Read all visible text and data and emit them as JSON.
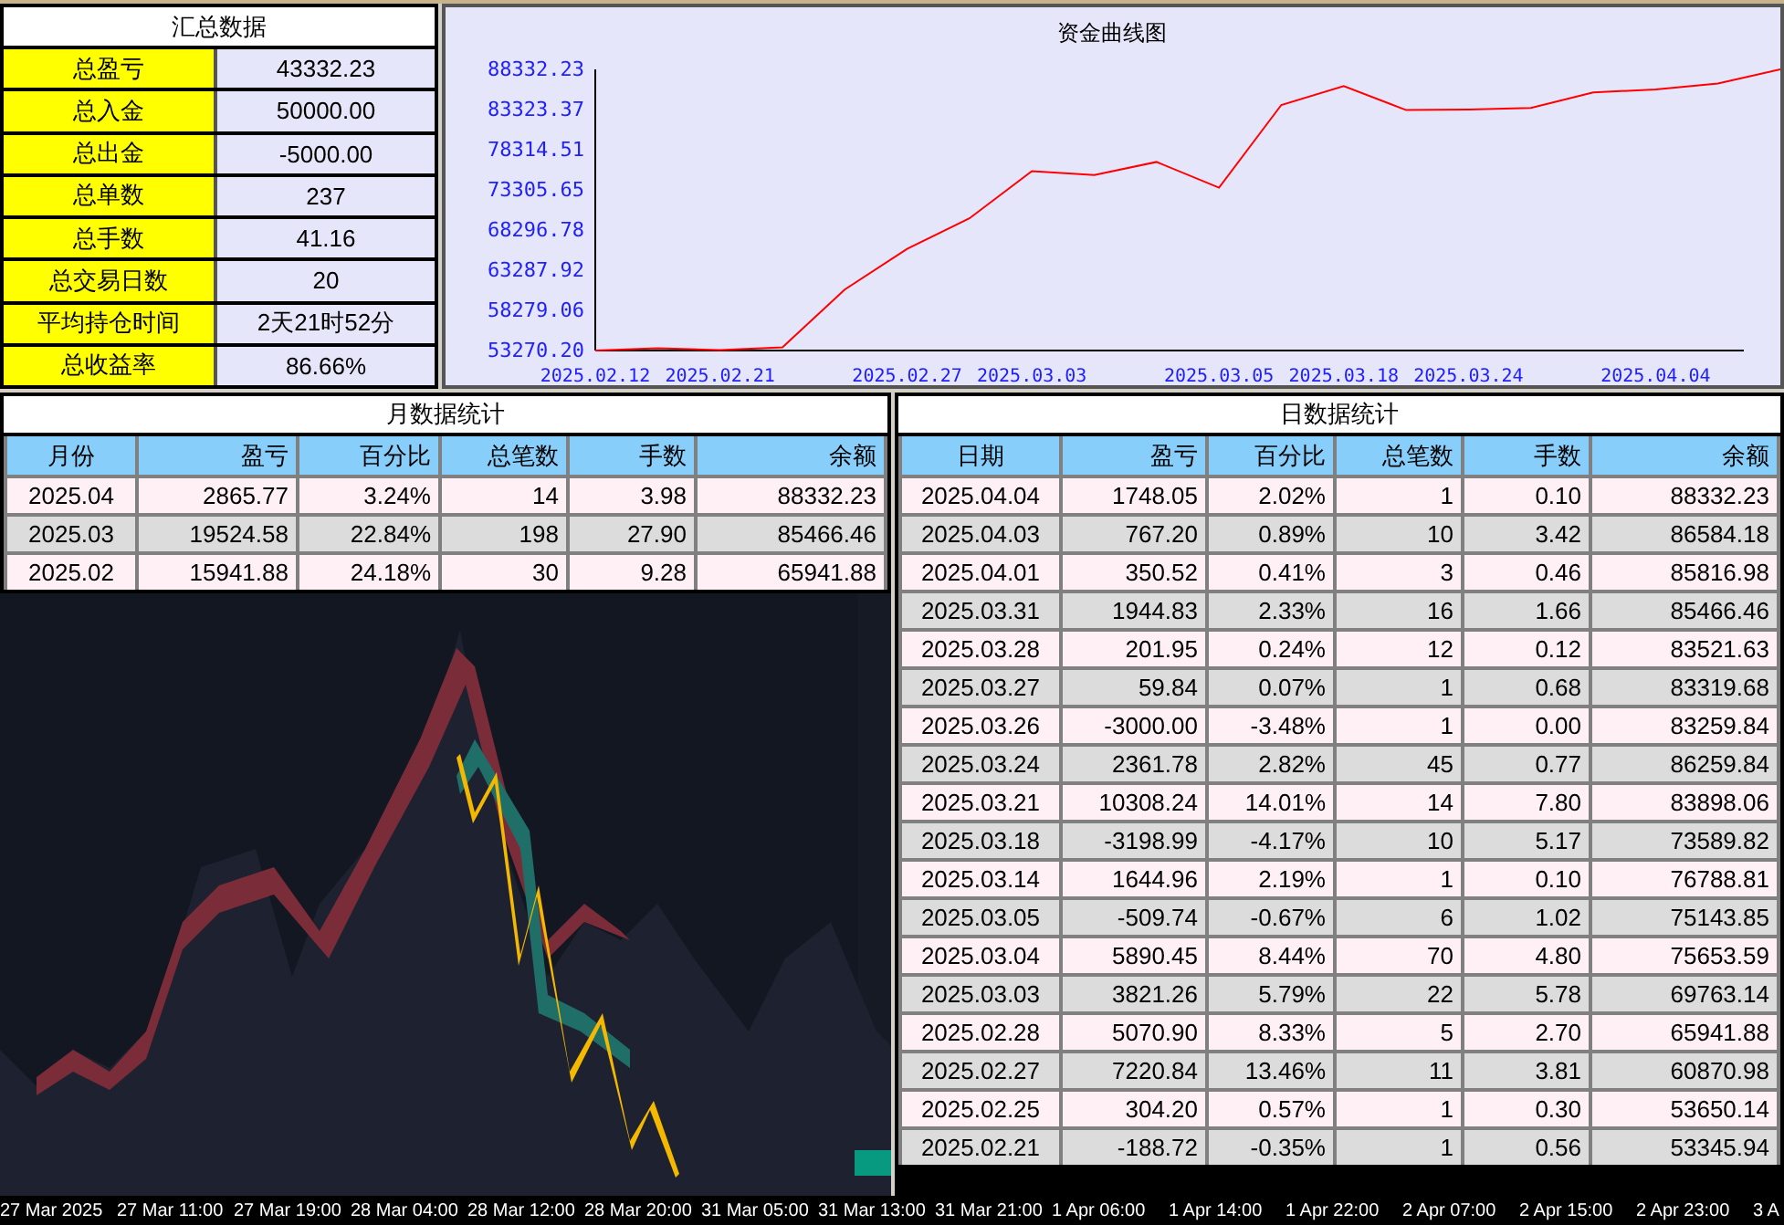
{
  "summary": {
    "title": "汇总数据",
    "rows": [
      {
        "label": "总盈亏",
        "value": "43332.23"
      },
      {
        "label": "总入金",
        "value": "50000.00"
      },
      {
        "label": "总出金",
        "value": "-5000.00"
      },
      {
        "label": "总单数",
        "value": "237"
      },
      {
        "label": "总手数",
        "value": "41.16"
      },
      {
        "label": "总交易日数",
        "value": "20"
      },
      {
        "label": "平均持仓时间",
        "value": "2天21时52分"
      },
      {
        "label": "总收益率",
        "value": "86.66%"
      }
    ]
  },
  "equity_chart": {
    "title": "资金曲线图",
    "chart_data": {
      "type": "line",
      "x": [
        "2025.02.12",
        null,
        "2025.02.21",
        null,
        null,
        "2025.02.27",
        null,
        "2025.03.03",
        null,
        null,
        "2025.03.05",
        null,
        "2025.03.18",
        null,
        "2025.03.24",
        null,
        null,
        "2025.04.04",
        null,
        null
      ],
      "series": [
        {
          "color": "#ff0000",
          "values": [
            53270.2,
            53535,
            53346,
            53650,
            60871,
            65942,
            69763,
            75654,
            75144,
            76789,
            73590,
            83898,
            86260,
            83260,
            83320,
            83522,
            85466,
            85817,
            86584,
            88332.23
          ]
        }
      ],
      "ylim": [
        53270.2,
        88332.23
      ],
      "yticks": [
        {
          "value": 88332.23,
          "label": "88332.23"
        },
        {
          "value": 83323.37,
          "label": "83323.37"
        },
        {
          "value": 78314.51,
          "label": "78314.51"
        },
        {
          "value": 73305.65,
          "label": "73305.65"
        },
        {
          "value": 68296.78,
          "label": "68296.78"
        },
        {
          "value": 63287.92,
          "label": "63287.92"
        },
        {
          "value": 58279.06,
          "label": "58279.06"
        },
        {
          "value": 53270.2,
          "label": "53270.20"
        }
      ]
    }
  },
  "monthly": {
    "title": "月数据统计",
    "columns": [
      "月份",
      "盈亏",
      "百分比",
      "总笔数",
      "手数",
      "余额"
    ],
    "rows": [
      [
        "2025.04",
        "2865.77",
        "3.24%",
        "14",
        "3.98",
        "88332.23"
      ],
      [
        "2025.03",
        "19524.58",
        "22.84%",
        "198",
        "27.90",
        "85466.46"
      ],
      [
        "2025.02",
        "15941.88",
        "24.18%",
        "30",
        "9.28",
        "65941.88"
      ]
    ]
  },
  "daily": {
    "title": "日数据统计",
    "columns": [
      "日期",
      "盈亏",
      "百分比",
      "总笔数",
      "手数",
      "余额"
    ],
    "rows": [
      [
        "2025.04.04",
        "1748.05",
        "2.02%",
        "1",
        "0.10",
        "88332.23"
      ],
      [
        "2025.04.03",
        "767.20",
        "0.89%",
        "10",
        "3.42",
        "86584.18"
      ],
      [
        "2025.04.01",
        "350.52",
        "0.41%",
        "3",
        "0.46",
        "85816.98"
      ],
      [
        "2025.03.31",
        "1944.83",
        "2.33%",
        "16",
        "1.66",
        "85466.46"
      ],
      [
        "2025.03.28",
        "201.95",
        "0.24%",
        "12",
        "0.12",
        "83521.63"
      ],
      [
        "2025.03.27",
        "59.84",
        "0.07%",
        "1",
        "0.68",
        "83319.68"
      ],
      [
        "2025.03.26",
        "-3000.00",
        "-3.48%",
        "1",
        "0.00",
        "83259.84"
      ],
      [
        "2025.03.24",
        "2361.78",
        "2.82%",
        "45",
        "0.77",
        "86259.84"
      ],
      [
        "2025.03.21",
        "10308.24",
        "14.01%",
        "14",
        "7.80",
        "83898.06"
      ],
      [
        "2025.03.18",
        "-3198.99",
        "-4.17%",
        "10",
        "5.17",
        "73589.82"
      ],
      [
        "2025.03.14",
        "1644.96",
        "2.19%",
        "1",
        "0.10",
        "76788.81"
      ],
      [
        "2025.03.05",
        "-509.74",
        "-0.67%",
        "6",
        "1.02",
        "75143.85"
      ],
      [
        "2025.03.04",
        "5890.45",
        "8.44%",
        "70",
        "4.80",
        "75653.59"
      ],
      [
        "2025.03.03",
        "3821.26",
        "5.79%",
        "22",
        "5.78",
        "69763.14"
      ],
      [
        "2025.02.28",
        "5070.90",
        "8.33%",
        "5",
        "2.70",
        "65941.88"
      ],
      [
        "2025.02.27",
        "7220.84",
        "13.46%",
        "11",
        "3.81",
        "60870.98"
      ],
      [
        "2025.02.25",
        "304.20",
        "0.57%",
        "1",
        "0.30",
        "53650.14"
      ],
      [
        "2025.02.21",
        "-188.72",
        "-0.35%",
        "1",
        "0.56",
        "53345.94"
      ]
    ]
  },
  "price_chart": {
    "kind": "picture",
    "time_axis": [
      "27 Mar 2025",
      "27 Mar 11:00",
      "27 Mar 19:00",
      "28 Mar 04:00",
      "28 Mar 12:00",
      "28 Mar 20:00",
      "31 Mar 05:00",
      "31 Mar 13:00",
      "31 Mar 21:00",
      "1 Apr 06:00",
      "1 Apr 14:00",
      "1 Apr 22:00",
      "2 Apr 07:00",
      "2 Apr 15:00",
      "2 Apr 23:00",
      "3 A"
    ]
  }
}
